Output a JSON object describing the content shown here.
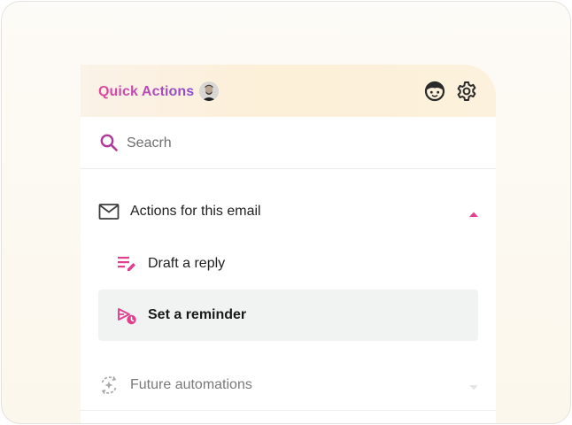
{
  "header": {
    "title": "Quick Actions",
    "avatar_icon": "user-avatar",
    "assistant_icon": "assistant-face-icon",
    "settings_icon": "gear-icon"
  },
  "search": {
    "placeholder": "Seacrh",
    "icon": "search-icon"
  },
  "sections": [
    {
      "label": "Actions for this email",
      "icon": "mail-icon",
      "expanded": true,
      "items": [
        {
          "label": "Draft a reply",
          "icon": "draft-edit-icon",
          "active": false
        },
        {
          "label": "Set a reminder",
          "icon": "reminder-clock-icon",
          "active": true
        }
      ]
    },
    {
      "label": "Future automations",
      "icon": "automation-sparkle-icon",
      "expanded": false,
      "disabled": true
    }
  ],
  "colors": {
    "accent_pink": "#e0408f",
    "accent_purple": "#8a4cd0",
    "header_bg": "#fcf0d8",
    "active_row_bg": "#f1f2f2"
  }
}
